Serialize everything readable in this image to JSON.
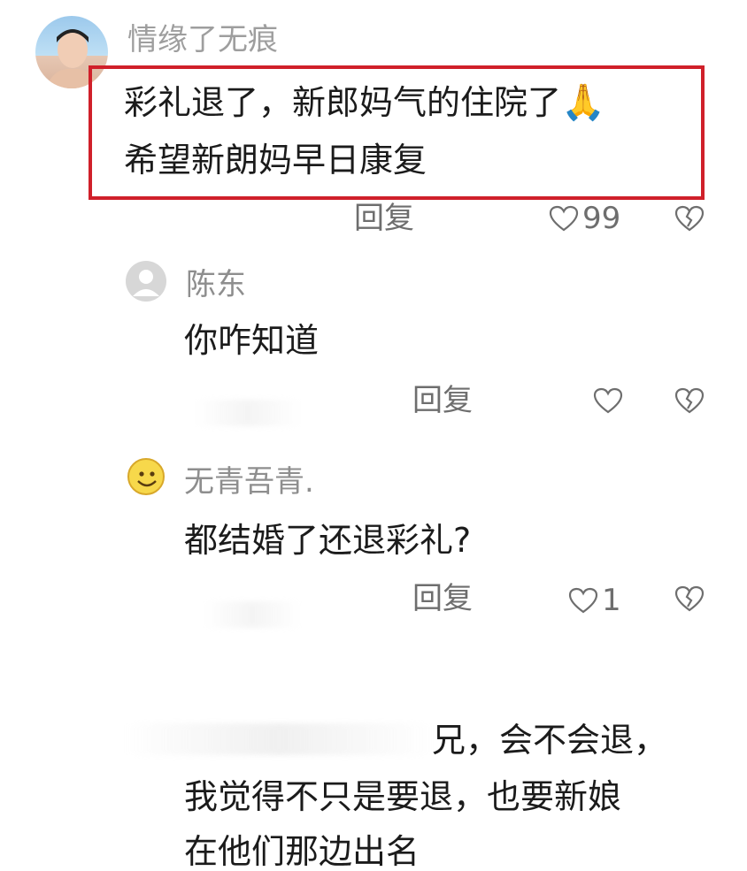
{
  "comments": [
    {
      "username": "情缘了无痕",
      "line1": "彩礼退了，新郎妈气的住院了",
      "emoji": "🙏",
      "line2": "希望新朗妈早日康复",
      "reply_label": "回复",
      "likes": "99"
    },
    {
      "username": "陈东",
      "text": "你咋知道",
      "reply_label": "回复",
      "likes": ""
    },
    {
      "username": "无青吾青.",
      "text": "都结婚了还退彩礼?",
      "reply_label": "回复",
      "likes": "1"
    },
    {
      "line1": "兄，会不会退，",
      "line2": "我觉得不只是要退，也要新娘",
      "line3": "在他们那边出名"
    }
  ],
  "colors": {
    "highlight_border": "#d0202a",
    "meta_text": "#6e6e6e",
    "username": "#8e8e8e"
  }
}
